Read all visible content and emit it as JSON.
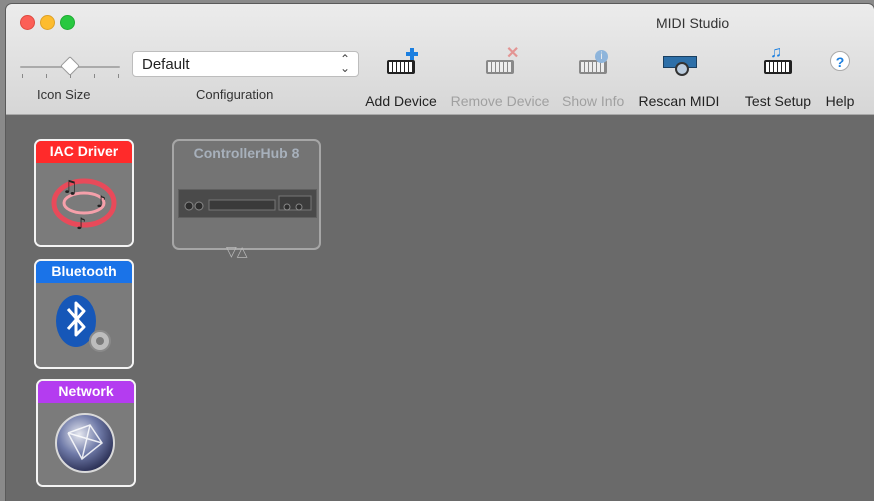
{
  "window": {
    "title": "MIDI Studio"
  },
  "toolbar": {
    "icon_size_label": "Icon Size",
    "configuration_label": "Configuration",
    "configuration_value": "Default",
    "icon_size_level": 0.45,
    "tools": [
      {
        "label": "Add Device",
        "enabled": true,
        "icon": "add-device-icon"
      },
      {
        "label": "Remove Device",
        "enabled": false,
        "icon": "remove-device-icon"
      },
      {
        "label": "Show Info",
        "enabled": false,
        "icon": "show-info-icon"
      },
      {
        "label": "Rescan MIDI",
        "enabled": true,
        "icon": "rescan-midi-icon"
      },
      {
        "label": "Test Setup",
        "enabled": true,
        "icon": "test-setup-icon"
      },
      {
        "label": "Help",
        "enabled": true,
        "icon": "help-icon"
      }
    ]
  },
  "devices": [
    {
      "name": "IAC Driver",
      "color": "#ff2a2a"
    },
    {
      "name": "Bluetooth",
      "color": "#1a73e8"
    },
    {
      "name": "Network",
      "color": "#b43cf0"
    },
    {
      "name": "ControllerHub 8",
      "color": "#a7b0bb"
    }
  ]
}
